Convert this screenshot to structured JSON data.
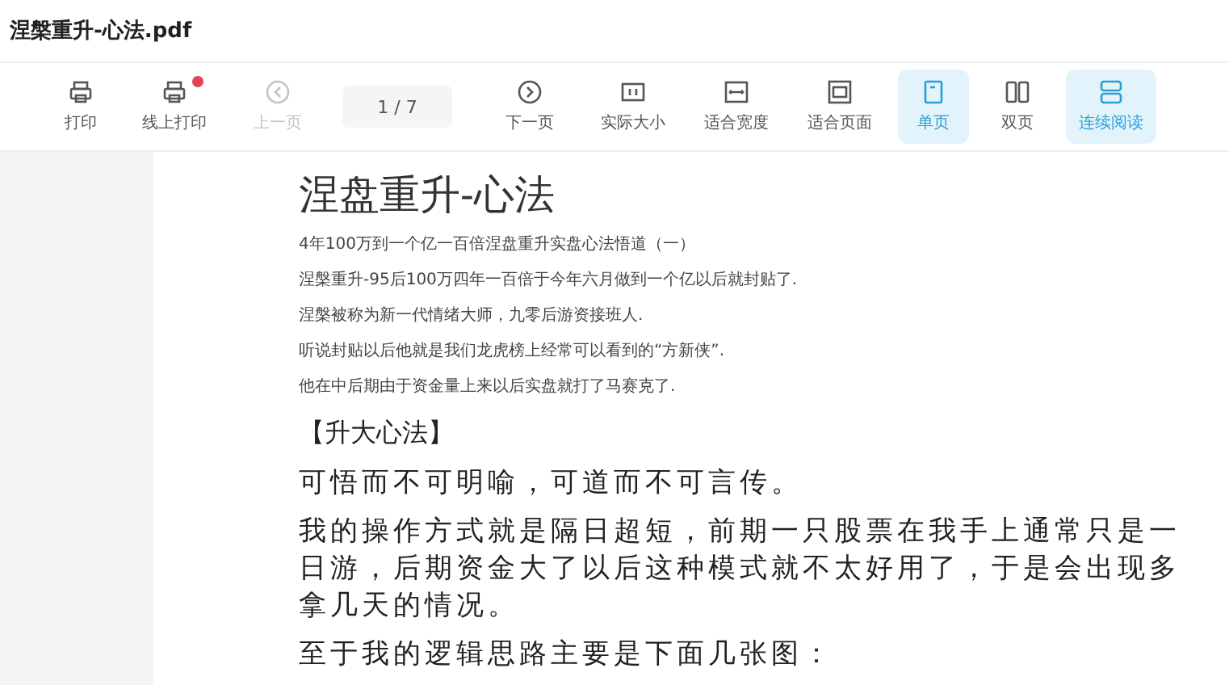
{
  "window": {
    "title": "涅槃重升-心法.pdf"
  },
  "toolbar": [
    {
      "kind": "print",
      "label": "打印",
      "disabled": false,
      "selected": false,
      "badge": false
    },
    {
      "kind": "cloud-print",
      "label": "线上打印",
      "disabled": false,
      "selected": false,
      "badge": true
    },
    {
      "kind": "prev",
      "label": "上一页",
      "disabled": true,
      "selected": false,
      "badge": false
    },
    {
      "kind": "page",
      "value": "1 / 7"
    },
    {
      "kind": "next",
      "label": "下一页",
      "disabled": false,
      "selected": false,
      "badge": false
    },
    {
      "kind": "actual",
      "label": "实际大小",
      "disabled": false,
      "selected": false,
      "badge": false
    },
    {
      "kind": "fit-width",
      "label": "适合宽度",
      "disabled": false,
      "selected": false,
      "badge": false
    },
    {
      "kind": "fit-page",
      "label": "适合页面",
      "disabled": false,
      "selected": false,
      "badge": false
    },
    {
      "kind": "single",
      "label": "单页",
      "disabled": false,
      "selected": true,
      "badge": false
    },
    {
      "kind": "double",
      "label": "双页",
      "disabled": false,
      "selected": false,
      "badge": false
    },
    {
      "kind": "continuous",
      "label": "连续阅读",
      "disabled": false,
      "selected": true,
      "badge": false
    }
  ],
  "document": {
    "title": "涅盘重升-心法",
    "intro": [
      "4年100万到一个亿一百倍涅盘重升实盘心法悟道（一）",
      "涅槃重升-95后100万四年一百倍于今年六月做到一个亿以后就封贴了.",
      "涅槃被称为新一代情绪大师，九零后游资接班人.",
      "听说封贴以后他就是我们龙虎榜上经常可以看到的“方新侠”.",
      "他在中后期由于资金量上来以后实盘就打了马赛克了."
    ],
    "heading": "【升大心法】",
    "paragraphs": [
      "可悟而不可明喻，可道而不可言传。",
      "我的操作方式就是隔日超短，前期一只股票在我手上通常只是一日游，后期资金大了以后这种模式就不太好用了，于是会出现多拿几天的情况。",
      "至于我的逻辑思路主要是下面几张图："
    ]
  }
}
